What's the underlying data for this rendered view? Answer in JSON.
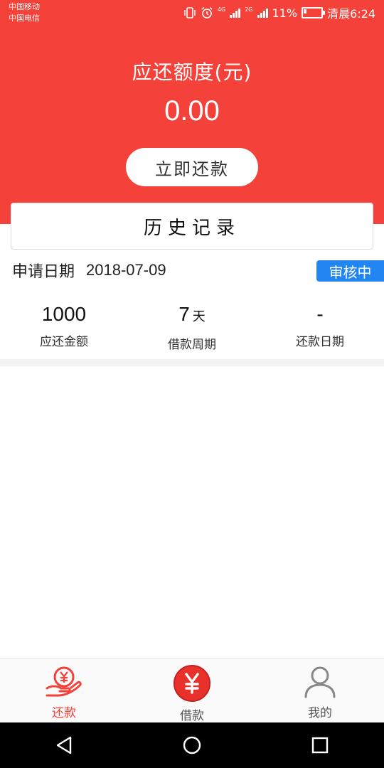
{
  "status_bar": {
    "carrier1": "中国移动",
    "carrier2": "中国电信",
    "net1": "4G",
    "net2": "2G",
    "battery": "11%",
    "time": "清晨6:24"
  },
  "header": {
    "title": "应还额度(元)",
    "amount": "0.00",
    "repay_label": "立即还款"
  },
  "history": {
    "title": "历史记录"
  },
  "record": {
    "apply_label": "申请日期",
    "apply_date": "2018-07-09",
    "status": "审核中",
    "amount_value": "1000",
    "amount_label": "应还金额",
    "period_value": "7",
    "period_unit": "天",
    "period_label": "借款周期",
    "due_value": "-",
    "due_label": "还款日期"
  },
  "tabs": [
    {
      "label": "还款",
      "icon": "repay-hand-yen-icon",
      "active": true
    },
    {
      "label": "借款",
      "icon": "yen-coin-icon",
      "active": false
    },
    {
      "label": "我的",
      "icon": "user-icon",
      "active": false
    }
  ],
  "colors": {
    "primary": "#f4413a",
    "badge": "#2286f2",
    "text": "#222222"
  }
}
